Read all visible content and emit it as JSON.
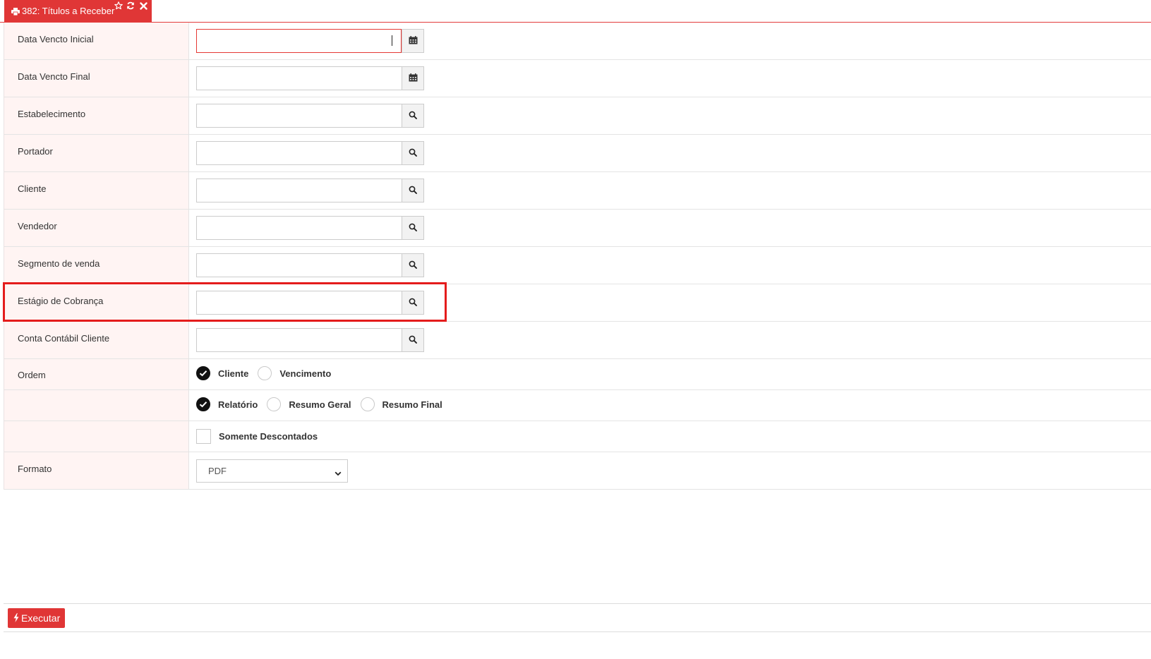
{
  "tab": {
    "title": "382: Títulos a Receber",
    "icons": {
      "print": "print-icon",
      "favorite": "star-icon",
      "refresh": "refresh-icon",
      "close": "close-icon"
    }
  },
  "fields": [
    {
      "label": "Data Vencto Inicial",
      "value": "",
      "button_icon": "calendar-icon",
      "focused": true
    },
    {
      "label": "Data Vencto Final",
      "value": "",
      "button_icon": "calendar-icon",
      "focused": false
    },
    {
      "label": "Estabelecimento",
      "value": "",
      "button_icon": "search-icon",
      "focused": false
    },
    {
      "label": "Portador",
      "value": "",
      "button_icon": "search-icon",
      "focused": false
    },
    {
      "label": "Cliente",
      "value": "",
      "button_icon": "search-icon",
      "focused": false
    },
    {
      "label": "Vendedor",
      "value": "",
      "button_icon": "search-icon",
      "focused": false
    },
    {
      "label": "Segmento de venda",
      "value": "",
      "button_icon": "search-icon",
      "focused": false
    },
    {
      "label": "Estágio de Cobrança",
      "value": "",
      "button_icon": "search-icon",
      "focused": false,
      "highlighted": true
    },
    {
      "label": "Conta Contábil Cliente",
      "value": "",
      "button_icon": "search-icon",
      "focused": false
    }
  ],
  "ordem": {
    "label": "Ordem",
    "options": [
      {
        "label": "Cliente",
        "selected": true
      },
      {
        "label": "Vencimento",
        "selected": false
      }
    ]
  },
  "tipo": {
    "label": "",
    "options": [
      {
        "label": "Relatório",
        "selected": true
      },
      {
        "label": "Resumo Geral",
        "selected": false
      },
      {
        "label": "Resumo Final",
        "selected": false
      }
    ]
  },
  "somente_descontados": {
    "label": "Somente Descontados",
    "checked": false
  },
  "formato": {
    "label": "Formato",
    "selected": "PDF"
  },
  "footer": {
    "execute_label": "Executar",
    "execute_icon": "bolt-icon"
  },
  "colors": {
    "accent": "#e03636",
    "label_bg": "#fff4f3",
    "highlight": "#e41c1c"
  }
}
